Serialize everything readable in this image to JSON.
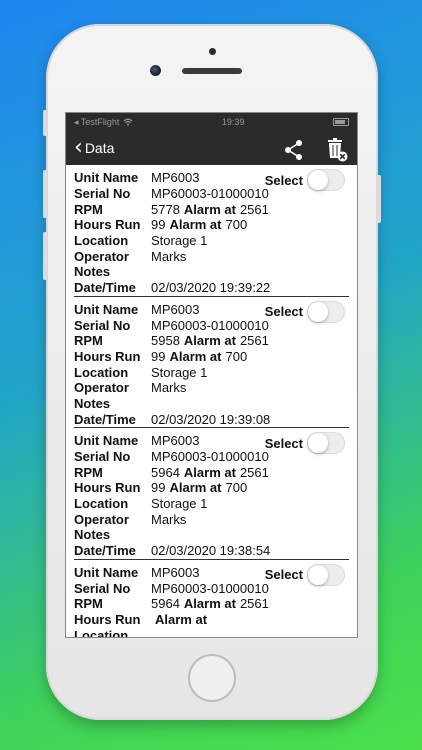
{
  "status": {
    "carrier": "◂ TestFlight",
    "time": "19:39"
  },
  "nav": {
    "back_label": "Data",
    "share_icon": "share-icon",
    "delete_icon": "trash-delete-icon"
  },
  "labels": {
    "unit_name": "Unit Name",
    "serial_no": "Serial No",
    "rpm": "RPM",
    "alarm_at": "Alarm at",
    "hours_run": "Hours Run",
    "location": "Location",
    "operator": "Operator",
    "notes": "Notes",
    "datetime": "Date/Time",
    "select": "Select"
  },
  "records": [
    {
      "unit_name": "MP6003",
      "serial_no": "MP60003-01000010",
      "rpm": "5778",
      "rpm_alarm": "2561",
      "hours_run": "99",
      "hours_alarm": "700",
      "location": "Storage 1",
      "operator": "Marks",
      "notes": "",
      "datetime": "02/03/2020 19:39:22",
      "selected": false
    },
    {
      "unit_name": "MP6003",
      "serial_no": "MP60003-01000010",
      "rpm": "5958",
      "rpm_alarm": "2561",
      "hours_run": "99",
      "hours_alarm": "700",
      "location": "Storage 1",
      "operator": "Marks",
      "notes": "",
      "datetime": "02/03/2020 19:39:08",
      "selected": false
    },
    {
      "unit_name": "MP6003",
      "serial_no": "MP60003-01000010",
      "rpm": "5964",
      "rpm_alarm": "2561",
      "hours_run": "99",
      "hours_alarm": "700",
      "location": "Storage 1",
      "operator": "Marks",
      "notes": "",
      "datetime": "02/03/2020 19:38:54",
      "selected": false
    },
    {
      "unit_name": "MP6003",
      "serial_no": "MP60003-01000010",
      "rpm": "5964",
      "rpm_alarm": "2561",
      "hours_run": "",
      "hours_alarm": "",
      "location": "",
      "operator": "",
      "notes": "",
      "datetime": "",
      "selected": false
    }
  ],
  "colors": {
    "navbar": "#2b2b2b",
    "toggle_off": "#ededed"
  }
}
